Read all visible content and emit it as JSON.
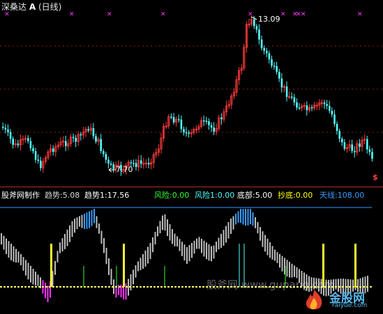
{
  "title": {
    "stock": "深桑达",
    "mark": "A",
    "period": "(日线)"
  },
  "price_chart": {
    "high_label": "13.09",
    "low_label": "7.70",
    "colors": {
      "up": "#ff3b3b",
      "down": "#54ffff",
      "cross": "#ff33ff",
      "grid": "#8a1a1a",
      "arrow": "#ffffff"
    }
  },
  "indicator": {
    "name": "股斧网制作",
    "params": [
      {
        "label": "趋势:5.08",
        "color": "#d8d8d8"
      },
      {
        "label": "趋势1:17.56",
        "color": "#ffffff"
      },
      {
        "label": "风险:0.00",
        "color": "#33ff33"
      },
      {
        "label": "风险1:0.00",
        "color": "#54ffff"
      },
      {
        "label": "底部:5.00",
        "color": "#ffffff"
      },
      {
        "label": "抄底:0.00",
        "color": "#ffff00"
      },
      {
        "label": "天线:108.00",
        "color": "#3a9cff"
      }
    ],
    "colors": {
      "band": "#bdbdbd",
      "top": "#3a9cff",
      "bottom": "#ff33ff",
      "signal": "#ffff33",
      "risk": "#33ff33",
      "risk1": "#54ffff",
      "baseline": "#ffff66",
      "antenna": "#3a9cff"
    }
  },
  "watermark": "股斧网  www.gupang.com",
  "logo": {
    "main": "金股网",
    "sub": "raiyue.com"
  }
}
